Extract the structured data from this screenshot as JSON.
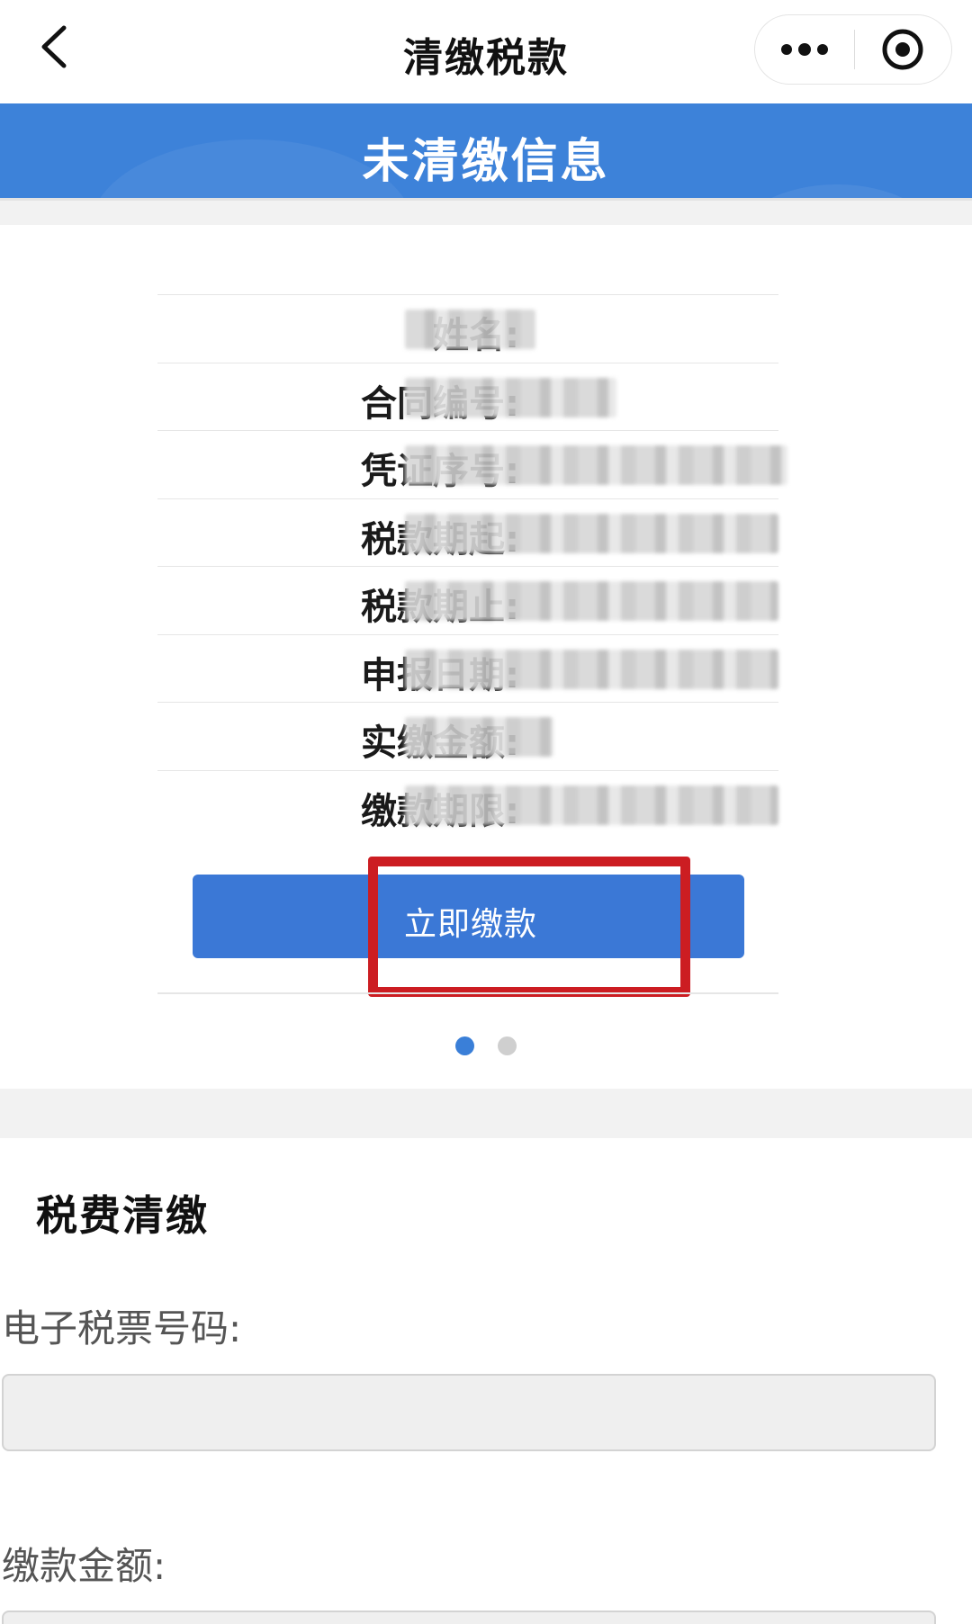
{
  "nav": {
    "title": "清缴税款",
    "back_icon": "chevron-left-icon",
    "more_icon": "more-dots-icon",
    "close_icon": "target-close-icon"
  },
  "banner": {
    "title": "未清缴信息"
  },
  "info": {
    "rows": [
      {
        "label": "姓名:",
        "value": "██ ██"
      },
      {
        "label": "合同编号:",
        "value": "████████"
      },
      {
        "label": "凭证序号:",
        "value": "████████████████"
      },
      {
        "label": "税款期起:",
        "value": "████-██-██ ██:██:██"
      },
      {
        "label": "税款期止:",
        "value": "████-██-██ ██:██:██"
      },
      {
        "label": "申报日期:",
        "value": "████-██-██ ██:██:██"
      },
      {
        "label": "实缴金额:",
        "value": "██████"
      },
      {
        "label": "缴款期限:",
        "value": "████-██-██ ██:██:██"
      }
    ],
    "pay_button_label": "立即缴款"
  },
  "pager": {
    "current": 1,
    "total": 2
  },
  "payment_section": {
    "title": "税费清缴",
    "ticket_label": "电子税票号码:",
    "ticket_value": "",
    "amount_label": "缴款金额:",
    "amount_value": ""
  },
  "colors": {
    "brand_blue": "#3d82d9",
    "button_blue": "#3b78d6",
    "highlight_red": "#cc1d22"
  }
}
